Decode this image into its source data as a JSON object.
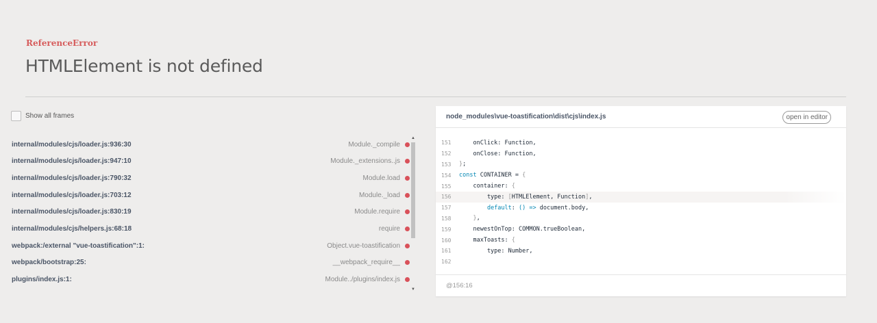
{
  "error": {
    "type": "ReferenceError",
    "message": "HTMLElement is not defined"
  },
  "show_all_frames": {
    "label": "Show all frames",
    "checked": false
  },
  "frames": [
    {
      "file": "internal/modules/cjs/loader.js:936:30",
      "method": "Module._compile"
    },
    {
      "file": "internal/modules/cjs/loader.js:947:10",
      "method": "Module._extensions..js"
    },
    {
      "file": "internal/modules/cjs/loader.js:790:32",
      "method": "Module.load"
    },
    {
      "file": "internal/modules/cjs/loader.js:703:12",
      "method": "Module._load"
    },
    {
      "file": "internal/modules/cjs/loader.js:830:19",
      "method": "Module.require"
    },
    {
      "file": "internal/modules/cjs/helpers.js:68:18",
      "method": "require"
    },
    {
      "file": "webpack:/external \"vue-toastification\":1:",
      "method": "Object.vue-toastification"
    },
    {
      "file": "webpack/bootstrap:25:",
      "method": "__webpack_require__"
    },
    {
      "file": "plugins/index.js:1:",
      "method": "Module../plugins/index.js"
    }
  ],
  "code_panel": {
    "filename": "node_modules\\vue-toastification\\dist\\cjs\\index.js",
    "open_in_editor_label": "open in editor",
    "location": "@156:16",
    "highlight_line": 156,
    "lines": [
      {
        "no": "151",
        "text": "    onClick: Function,"
      },
      {
        "no": "152",
        "text": "    onClose: Function,"
      },
      {
        "no": "153",
        "text": "};"
      },
      {
        "no": "154",
        "text": "const CONTAINER = {"
      },
      {
        "no": "155",
        "text": "    container: {"
      },
      {
        "no": "156",
        "text": "        type: [HTMLElement, Function],"
      },
      {
        "no": "157",
        "text": "        default: () => document.body,"
      },
      {
        "no": "158",
        "text": "    },"
      },
      {
        "no": "159",
        "text": "    newestOnTop: COMMON.trueBoolean,"
      },
      {
        "no": "160",
        "text": "    maxToasts: {"
      },
      {
        "no": "161",
        "text": "        type: Number,"
      },
      {
        "no": "162",
        "text": ""
      }
    ]
  },
  "colors": {
    "error_type": "#d65c5c",
    "frame_dot": "#d9515a",
    "keyword": "#0086b3",
    "background": "#eeedec"
  },
  "icons": {
    "scroll_up": "triangle-up",
    "scroll_down": "triangle-down"
  }
}
